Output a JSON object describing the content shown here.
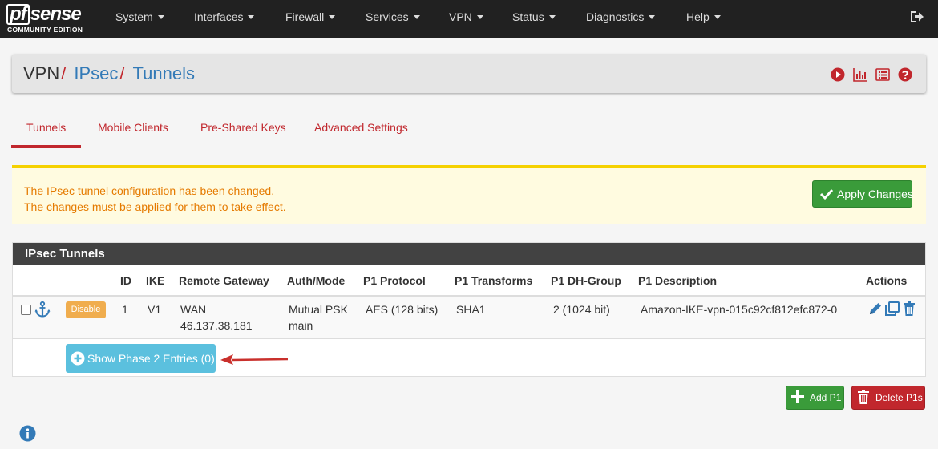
{
  "brand": {
    "logo_pf": "pf",
    "logo_sense": "sense",
    "logo_sub": "COMMUNITY EDITION"
  },
  "nav": [
    "System",
    "Interfaces",
    "Firewall",
    "Services",
    "VPN",
    "Status",
    "Diagnostics",
    "Help"
  ],
  "breadcrumb": {
    "root": "VPN",
    "sep": "/",
    "section": "IPsec",
    "page": "Tunnels"
  },
  "tabs": [
    "Tunnels",
    "Mobile Clients",
    "Pre-Shared Keys",
    "Advanced Settings"
  ],
  "alert": {
    "line1": "The IPsec tunnel configuration has been changed.",
    "line2": "The changes must be applied for them to take effect.",
    "button": "Apply Changes"
  },
  "panel": {
    "title": "IPsec Tunnels",
    "columns": [
      "ID",
      "IKE",
      "Remote Gateway",
      "Auth/Mode",
      "P1 Protocol",
      "P1 Transforms",
      "P1 DH-Group",
      "P1 Description",
      "Actions"
    ],
    "row": {
      "status_button": "Disable",
      "id": "1",
      "ike": "V1",
      "gateway_iface": "WAN",
      "gateway_ip": "46.137.38.181",
      "auth": "Mutual PSK",
      "mode": "main",
      "protocol": "AES (128 bits)",
      "transforms": "SHA1",
      "dh_group": "2 (1024 bit)",
      "description": "Amazon-IKE-vpn-015c92cf812efc872-0"
    },
    "phase2_button": "Show Phase 2 Entries (0)"
  },
  "buttons": {
    "add": "Add P1",
    "delete": "Delete P1s"
  },
  "colors": {
    "navbar": "#212121",
    "accent_red": "#c1272d",
    "link_blue": "#337ab7",
    "success": "#3a9b3a",
    "info": "#5bc0de",
    "warning": "#f0ad4e",
    "alert_text": "#e57a00"
  }
}
